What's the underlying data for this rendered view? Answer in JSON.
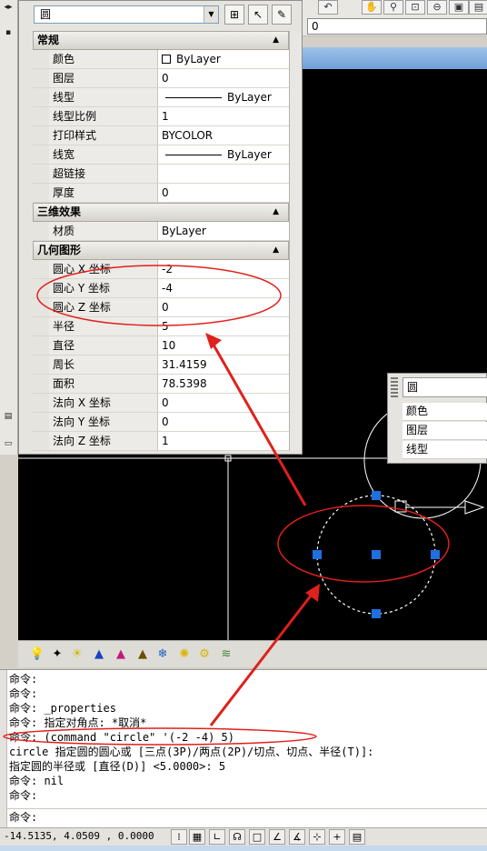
{
  "toolbar": {
    "layer_value": "0"
  },
  "properties_panel": {
    "object_type": "圆",
    "sections": [
      {
        "title": "常规",
        "rows": [
          {
            "key": "颜色",
            "value": "ByLayer"
          },
          {
            "key": "图层",
            "value": "0"
          },
          {
            "key": "线型",
            "value": "ByLayer"
          },
          {
            "key": "线型比例",
            "value": "1"
          },
          {
            "key": "打印样式",
            "value": "BYCOLOR"
          },
          {
            "key": "线宽",
            "value": "ByLayer"
          },
          {
            "key": "超链接",
            "value": ""
          },
          {
            "key": "厚度",
            "value": "0"
          }
        ]
      },
      {
        "title": "三维效果",
        "rows": [
          {
            "key": "材质",
            "value": "ByLayer"
          }
        ]
      },
      {
        "title": "几何图形",
        "rows": [
          {
            "key": "圆心 X 坐标",
            "value": "-2"
          },
          {
            "key": "圆心 Y 坐标",
            "value": "-4"
          },
          {
            "key": "圆心 Z 坐标",
            "value": "0"
          },
          {
            "key": "半径",
            "value": "5"
          },
          {
            "key": "直径",
            "value": "10"
          },
          {
            "key": "周长",
            "value": "31.4159"
          },
          {
            "key": "面积",
            "value": "78.5398"
          },
          {
            "key": "法向 X 坐标",
            "value": "0"
          },
          {
            "key": "法向 Y 坐标",
            "value": "0"
          },
          {
            "key": "法向 Z 坐标",
            "value": "1"
          }
        ]
      }
    ]
  },
  "quick_properties": {
    "title": "圆",
    "rows": [
      "颜色",
      "图层",
      "线型"
    ]
  },
  "command_history": [
    "命令:",
    "命令:",
    "命令: _properties",
    "命令: 指定对角点: *取消*",
    "命令: (command \"circle\" '(-2 -4) 5)",
    "circle 指定圆的圆心或 [三点(3P)/两点(2P)/切点、切点、半径(T)]:",
    "指定圆的半径或 [直径(D)] <5.0000>: 5",
    "命令: nil",
    "命令:"
  ],
  "command_prompt": "命令:",
  "status_bar": {
    "coordinates": "-14.5135, 4.0509 , 0.0000"
  },
  "colors": {
    "annotation_red": "#e0201c",
    "grip_blue": "#1f6fe0",
    "drawing_bg": "#000000"
  }
}
